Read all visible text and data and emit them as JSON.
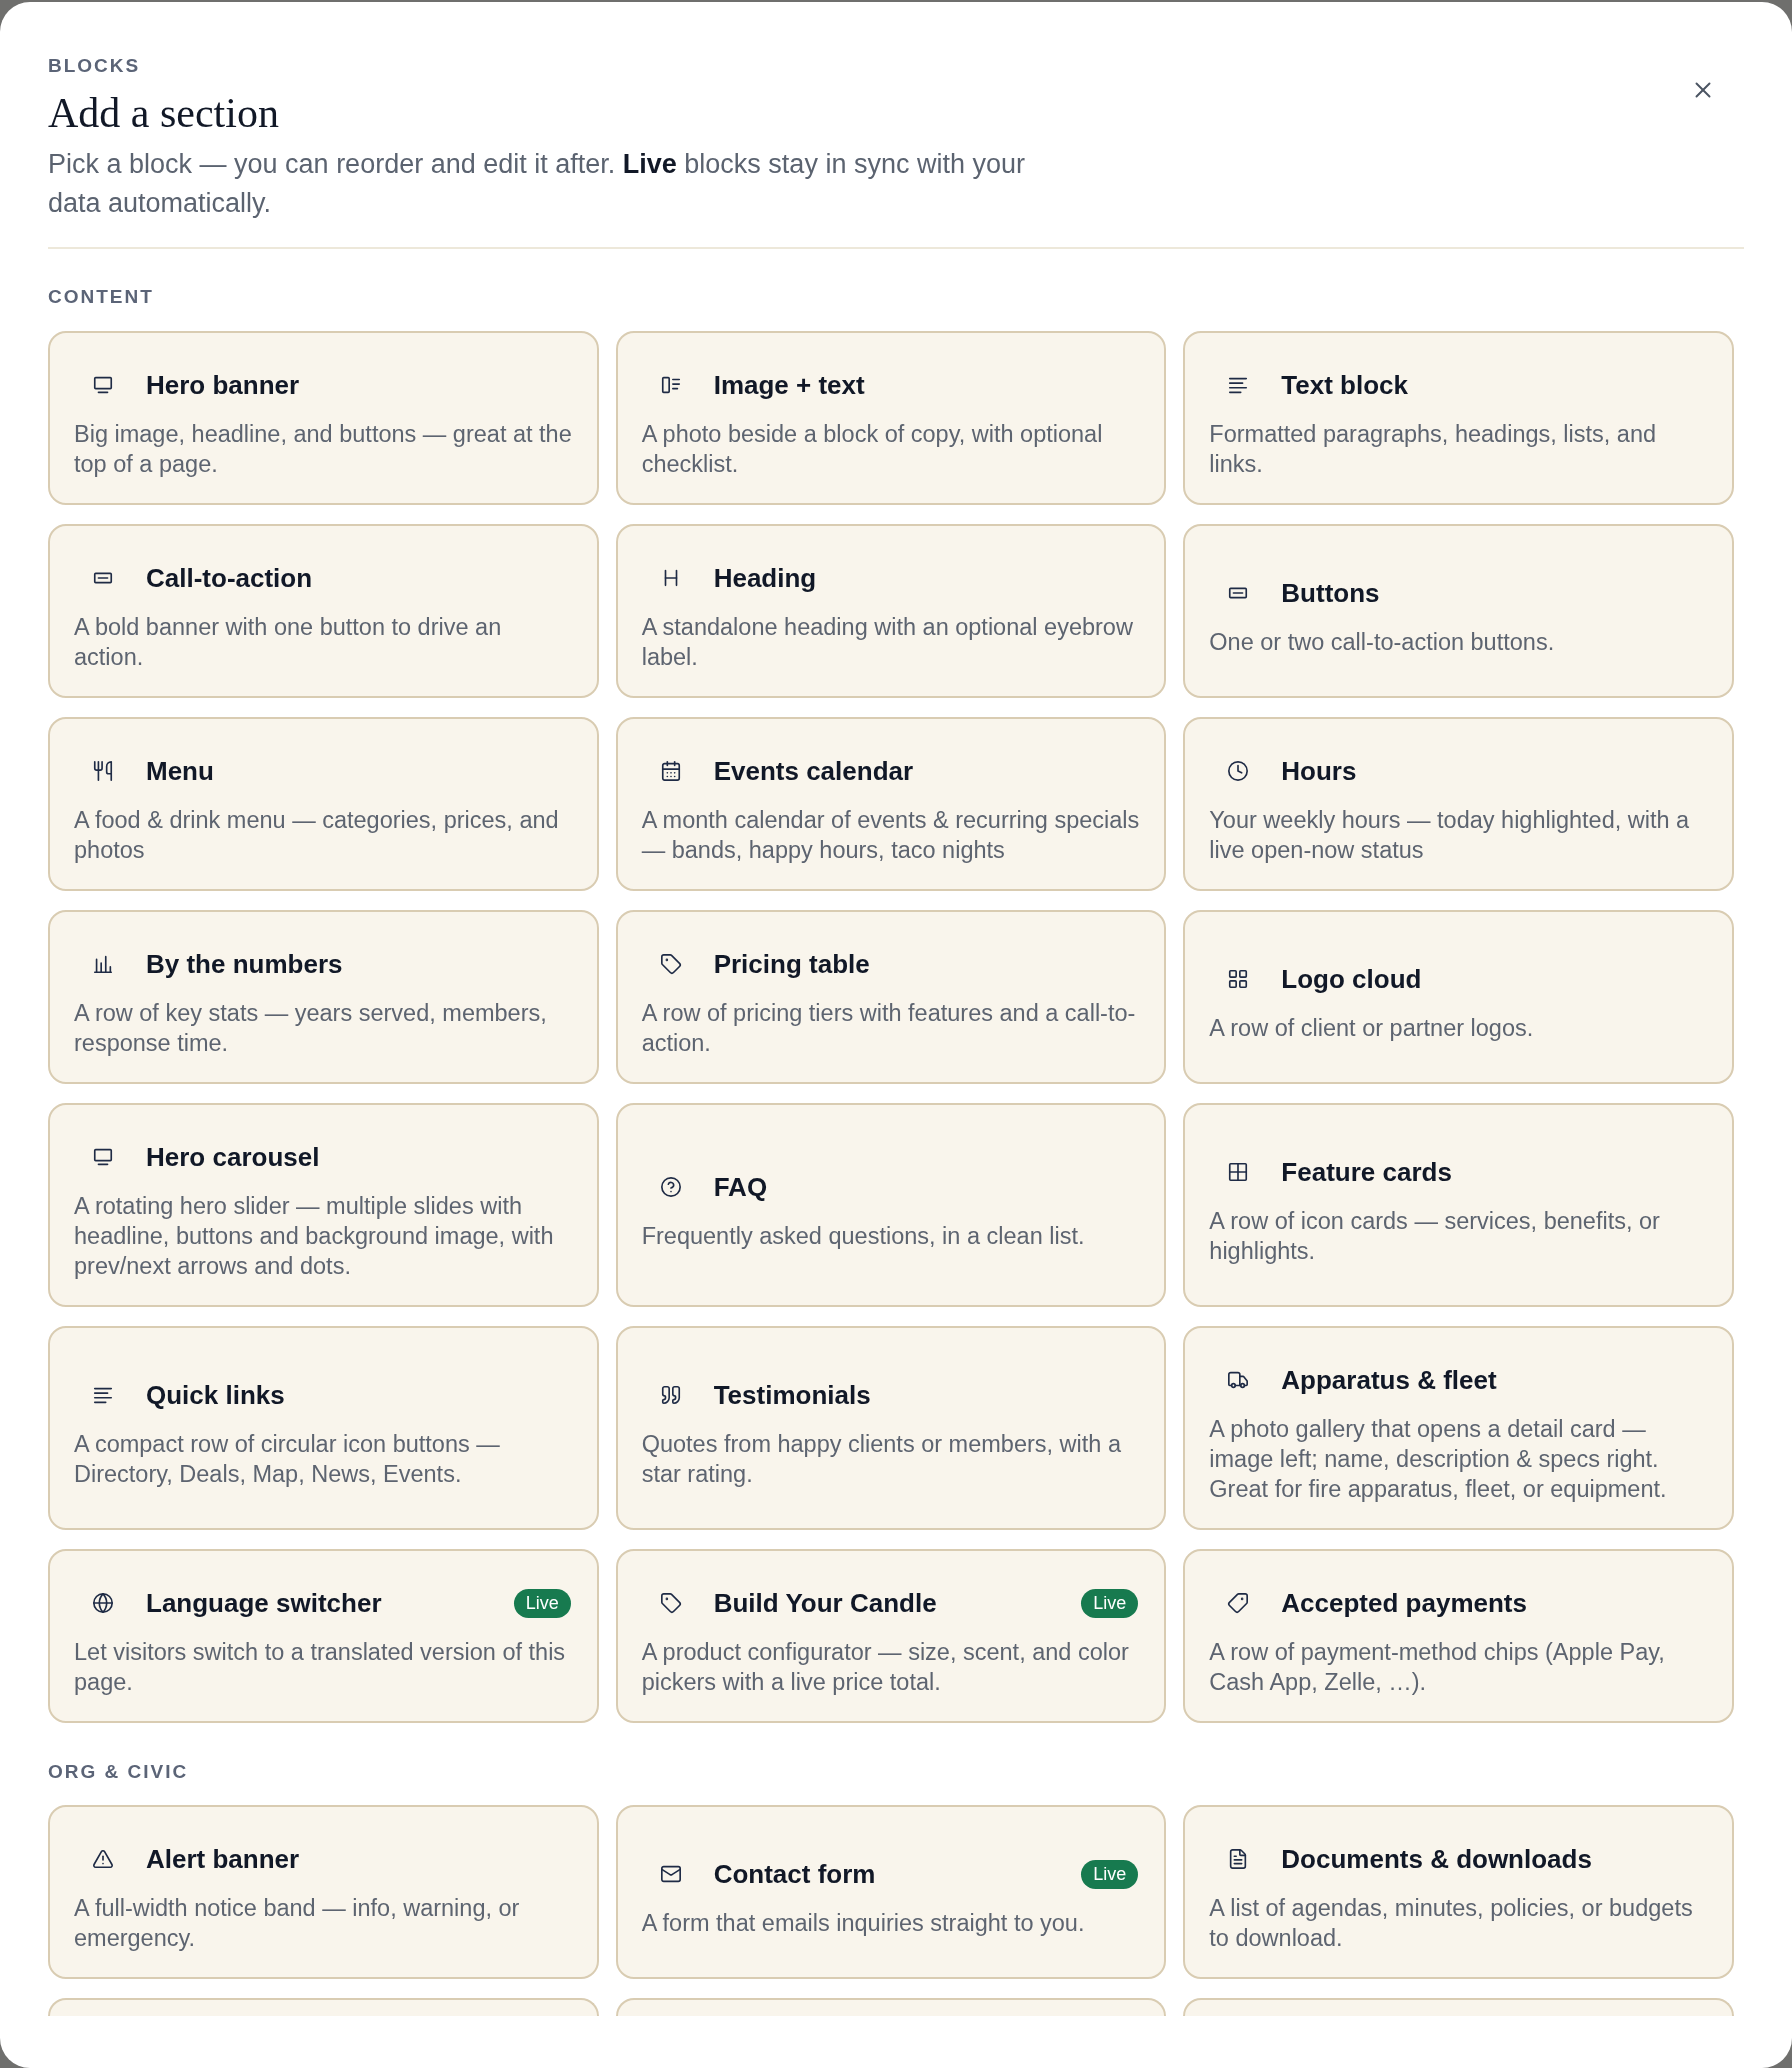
{
  "header": {
    "eyebrow": "BLOCKS",
    "title": "Add a section",
    "description": "Pick a block — you can reorder and edit it after. **Live** blocks stay in sync with your data automatically."
  },
  "sections": [
    {
      "heading": "CONTENT",
      "blocks": [
        {
          "title": "Hero banner",
          "description": "Big image, headline, and buttons — great at the top of a page."
        },
        {
          "title": "Image + text",
          "description": "A photo beside a block of copy, with optional checklist."
        },
        {
          "title": "Text block",
          "description": "Formatted paragraphs, headings, lists, and links."
        },
        {
          "title": "Call-to-action",
          "description": "A bold banner with one button to drive an action."
        },
        {
          "title": "Heading",
          "description": "A standalone heading with an optional eyebrow label."
        },
        {
          "title": "Buttons",
          "description": "One or two call-to-action buttons."
        },
        {
          "title": "Menu",
          "description": "A food & drink menu — categories, prices, and photos"
        },
        {
          "title": "Events calendar",
          "description": "A month calendar of events & recurring specials — bands, happy hours, taco nights"
        },
        {
          "title": "Hours",
          "description": "Your weekly hours — today highlighted, with a live open-now status"
        },
        {
          "title": "By the numbers",
          "description": "A row of key stats — years served, members, response time."
        },
        {
          "title": "Pricing table",
          "description": "A row of pricing tiers with features and a call-to-action."
        },
        {
          "title": "Logo cloud",
          "description": "A row of client or partner logos."
        },
        {
          "title": "Hero carousel",
          "description": "A rotating hero slider — multiple slides with headline, buttons and background image, with prev/next arrows and dots."
        },
        {
          "title": "FAQ",
          "description": "Frequently asked questions, in a clean list."
        },
        {
          "title": "Feature cards",
          "description": "A row of icon cards — services, benefits, or highlights."
        },
        {
          "title": "Quick links",
          "description": "A compact row of circular icon buttons — Directory, Deals, Map, News, Events."
        },
        {
          "title": "Testimonials",
          "description": "Quotes from happy clients or members, with a star rating."
        },
        {
          "title": "Apparatus & fleet",
          "description": "A photo gallery that opens a detail card — image left; name, description & specs right. Great for fire apparatus, fleet, or equipment."
        },
        {
          "title": "Language switcher",
          "badge": "Live",
          "description": "Let visitors switch to a translated version of this page."
        },
        {
          "title": "Build Your Candle",
          "badge": "Live",
          "description": "A product configurator — size, scent, and color pickers with a live price total."
        },
        {
          "title": "Accepted payments",
          "description": "A row of payment-method chips (Apple Pay, Cash App, Zelle, …)."
        }
      ]
    },
    {
      "heading": "ORG & CIVIC",
      "blocks": [
        {
          "title": "Alert banner",
          "description": "A full-width notice band — info, warning, or emergency."
        },
        {
          "title": "Contact form",
          "badge": "Live",
          "description": "A form that emails inquiries straight to you."
        },
        {
          "title": "Documents & downloads",
          "description": "A list of agendas, minutes, policies, or budgets to download."
        }
      ]
    }
  ]
}
